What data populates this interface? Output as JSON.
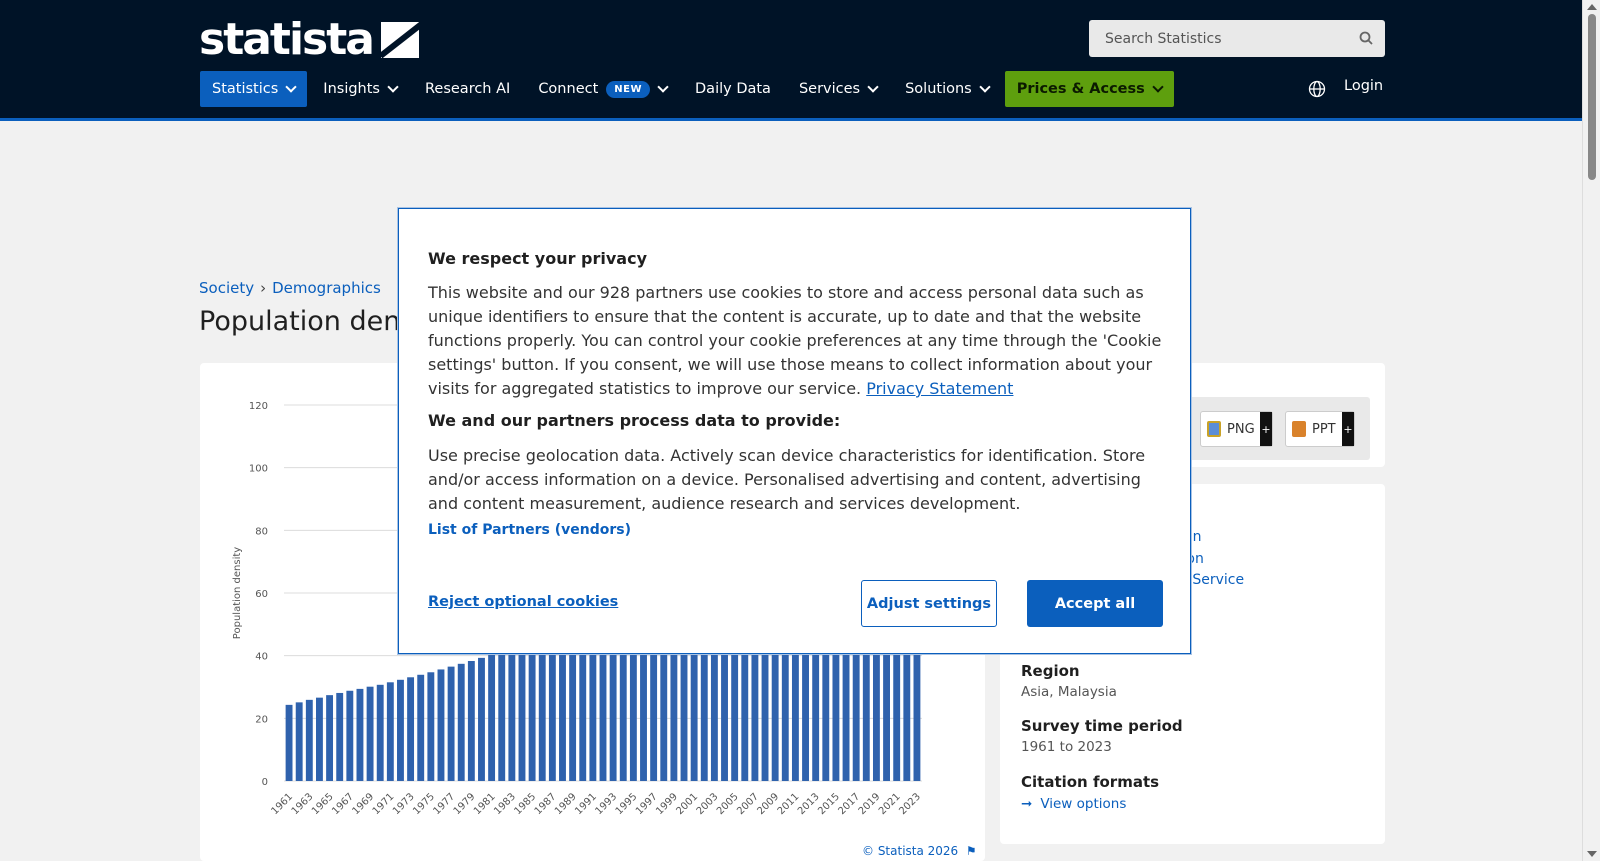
{
  "header": {
    "logo_text": "statista",
    "search_placeholder": "Search Statistics",
    "nav": [
      {
        "label": "Statistics"
      },
      {
        "label": "Insights"
      },
      {
        "label": "Research AI"
      },
      {
        "label": "Connect",
        "badge": "NEW"
      },
      {
        "label": "Daily Data"
      },
      {
        "label": "Services"
      },
      {
        "label": "Solutions"
      },
      {
        "label": "Prices & Access"
      }
    ],
    "login": "Login"
  },
  "breadcrumb": [
    "Society",
    "Demographics"
  ],
  "page_title": "Population den",
  "chart": {
    "copyright": "© Statista 2026"
  },
  "tools": {
    "png": "PNG",
    "ppt": "PPT",
    "plus": "+"
  },
  "info": {
    "link_fragments": [
      "on",
      "tion",
      "h Service"
    ],
    "region_label": "Region",
    "region_value": "Asia, Malaysia",
    "survey_label": "Survey time period",
    "survey_value": "1961 to 2023",
    "citation_label": "Citation formats",
    "citation_link": "View options"
  },
  "modal": {
    "title": "We respect your privacy",
    "body_text": "This website and our 928 partners use cookies to store and access personal data such as unique identifiers to ensure that the content is accurate, up to date and that the website functions properly. You can control your cookie preferences at any time through the 'Cookie settings' button. If you consent, we will use those means to collect information about your visits for aggregated statistics to improve our service.",
    "privacy_link": "Privacy Statement",
    "subtitle": "We and our partners process data to provide:",
    "purposes": "Use precise geolocation data. Actively scan device characteristics for identification. Store and/or access information on a device. Personalised advertising and content, advertising and content measurement, audience research and services development.",
    "vendors_link": "List of Partners (vendors)",
    "reject": "Reject optional cookies",
    "adjust": "Adjust settings",
    "accept": "Accept all"
  },
  "colors": {
    "brand_navy": "#001327",
    "accent_blue": "#0b5fbd",
    "prices_green": "#5e9f0e",
    "bar_blue": "#2f62ad"
  },
  "chart_data": {
    "type": "bar",
    "ylabel": "Population density",
    "ylim": [
      0,
      120
    ],
    "yticks": [
      0,
      20,
      40,
      60,
      80,
      100,
      120
    ],
    "x_tick_labels": [
      "1961",
      "1963",
      "1965",
      "1967",
      "1969",
      "1971",
      "1973",
      "1975",
      "1977",
      "1979",
      "1981",
      "1983",
      "1985",
      "1987",
      "1989",
      "1991",
      "1993",
      "1995",
      "1997",
      "1999",
      "2001",
      "2003",
      "2005",
      "2007",
      "2009",
      "2011",
      "2013",
      "2015",
      "2017",
      "2019",
      "2021",
      "2023"
    ],
    "categories": [
      "1961",
      "1962",
      "1963",
      "1964",
      "1965",
      "1966",
      "1967",
      "1968",
      "1969",
      "1970",
      "1971",
      "1972",
      "1973",
      "1974",
      "1975",
      "1976",
      "1977",
      "1978",
      "1979",
      "1980",
      "1981",
      "1982",
      "1983",
      "1984",
      "1985",
      "1986",
      "1987",
      "1988",
      "1989",
      "1990",
      "1991",
      "1992",
      "1993",
      "1994",
      "1995",
      "1996",
      "1997",
      "1998",
      "1999",
      "2000",
      "2001",
      "2002",
      "2003",
      "2004",
      "2005",
      "2006",
      "2007",
      "2008",
      "2009",
      "2010",
      "2011",
      "2012",
      "2013",
      "2014",
      "2015",
      "2016",
      "2017",
      "2018",
      "2019",
      "2020",
      "2021",
      "2022",
      "2023"
    ],
    "values": [
      24.3,
      25.1,
      25.9,
      26.6,
      27.4,
      28.1,
      28.8,
      29.4,
      30.1,
      30.7,
      31.5,
      32.3,
      33.1,
      33.9,
      34.7,
      35.6,
      36.5,
      37.4,
      38.3,
      39.3,
      40.4,
      41.5,
      42.7,
      43.9,
      45.1,
      46.3,
      47.5,
      48.7,
      49.9,
      51.1,
      52.4,
      53.6,
      54.9,
      56.2,
      57.5,
      58.8,
      60.1,
      61.4,
      62.7,
      64.0,
      65.3,
      66.6,
      67.8,
      69.0,
      70.2,
      71.3,
      72.4,
      73.5,
      74.6,
      75.7,
      77.0,
      78.3,
      79.5,
      80.7,
      81.8,
      83.0,
      84.2,
      85.4,
      86.5,
      87.5,
      88.3,
      89.3,
      90.4
    ]
  }
}
